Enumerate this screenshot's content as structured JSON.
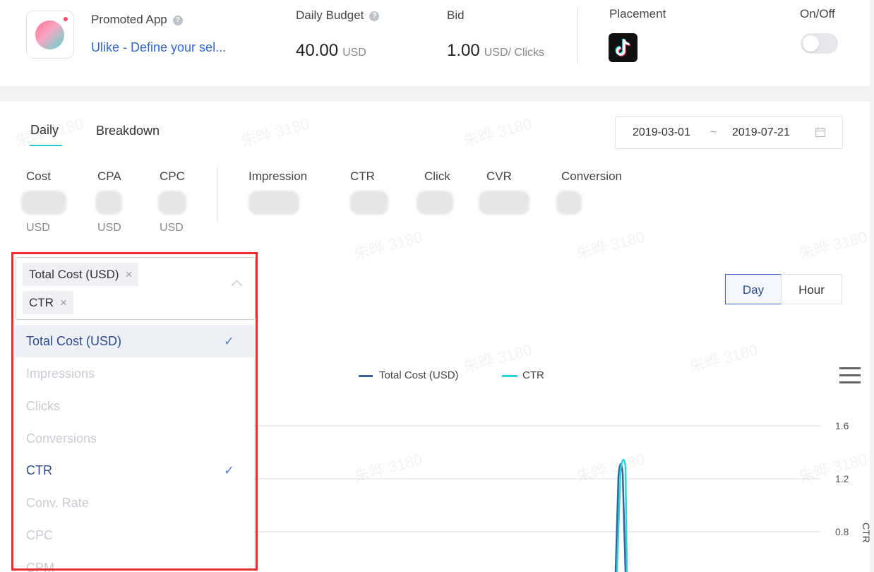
{
  "header": {
    "promoted_app_label": "Promoted App",
    "app_name": "Ulike - Define your sel...",
    "daily_budget_label": "Daily Budget",
    "daily_budget_value": "40.00",
    "daily_budget_unit": "USD",
    "bid_label": "Bid",
    "bid_value": "1.00",
    "bid_unit": "USD/ Clicks",
    "placement_label": "Placement",
    "onoff_label": "On/Off",
    "toggle_on": false,
    "help_glyph": "?"
  },
  "tabs": [
    {
      "label": "Daily",
      "active": true
    },
    {
      "label": "Breakdown",
      "active": false
    }
  ],
  "date_range": {
    "start": "2019-03-01",
    "sep": "~",
    "end": "2019-07-21"
  },
  "metrics": [
    {
      "label": "Cost",
      "unit": "USD"
    },
    {
      "label": "CPA",
      "unit": "USD"
    },
    {
      "label": "CPC",
      "unit": "USD"
    },
    {
      "label": "Impression",
      "unit": ""
    },
    {
      "label": "CTR",
      "unit": ""
    },
    {
      "label": "Click",
      "unit": ""
    },
    {
      "label": "CVR",
      "unit": ""
    },
    {
      "label": "Conversion",
      "unit": ""
    }
  ],
  "selector": {
    "tags": [
      "Total Cost (USD)",
      "CTR"
    ],
    "remove_glyph": "×",
    "options": [
      {
        "label": "Total Cost (USD)",
        "selected": true
      },
      {
        "label": "Impressions",
        "selected": false
      },
      {
        "label": "Clicks",
        "selected": false
      },
      {
        "label": "Conversions",
        "selected": false
      },
      {
        "label": "CTR",
        "selected": true
      },
      {
        "label": "Conv. Rate",
        "selected": false
      },
      {
        "label": "CPC",
        "selected": false
      },
      {
        "label": "CPM",
        "selected": false
      }
    ],
    "check_glyph": "✓"
  },
  "granularity": {
    "day": "Day",
    "hour": "Hour",
    "active": "Day"
  },
  "chart_data": {
    "type": "line",
    "series": [
      {
        "name": "Total Cost (USD)",
        "color": "#3a5f9a"
      },
      {
        "name": "CTR",
        "color": "#2dd4e0"
      }
    ],
    "y_right_label": "CTR",
    "y_right_ticks": [
      "1.6",
      "1.2",
      "0.8"
    ],
    "grid": true
  },
  "watermark": "朱晔 3180",
  "colors": {
    "accent": "#2bc7c9",
    "primary": "#3b63c8",
    "link": "#3366cc",
    "outline": "#ee2b2b"
  }
}
